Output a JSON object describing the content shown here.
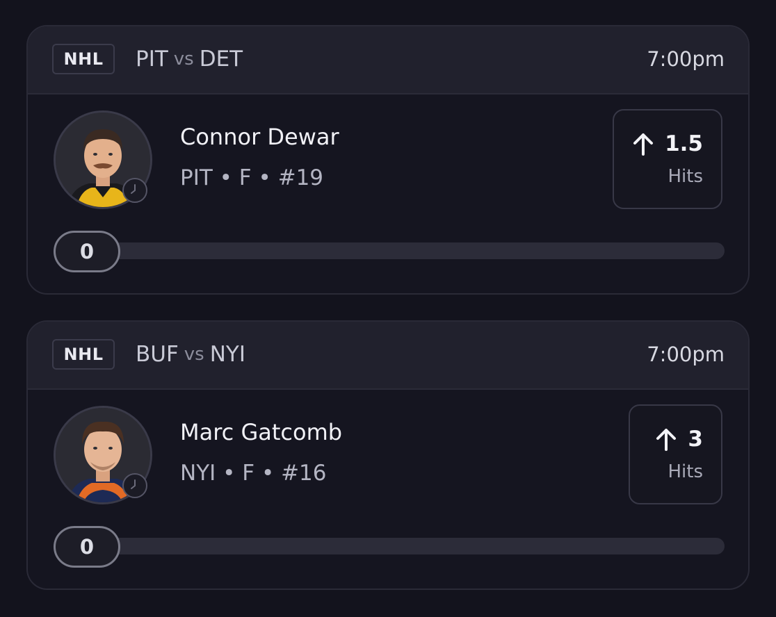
{
  "cards": [
    {
      "league": "NHL",
      "home_team": "PIT",
      "vs": "vs",
      "away_team": "DET",
      "time": "7:00pm",
      "player": {
        "name": "Connor Dewar",
        "meta": "PIT • F • #19",
        "jersey_color": "#e8b51a"
      },
      "prop": {
        "line": "1.5",
        "stat": "Hits",
        "direction": "arrow-up-icon"
      },
      "progress": {
        "value": "0",
        "fraction": 0
      }
    },
    {
      "league": "NHL",
      "home_team": "BUF",
      "vs": "vs",
      "away_team": "NYI",
      "time": "7:00pm",
      "player": {
        "name": "Marc Gatcomb",
        "meta": "NYI • F • #16",
        "jersey_color": "#e26a25"
      },
      "prop": {
        "line": "3",
        "stat": "Hits",
        "direction": "arrow-up-icon"
      },
      "progress": {
        "value": "0",
        "fraction": 0
      }
    }
  ]
}
